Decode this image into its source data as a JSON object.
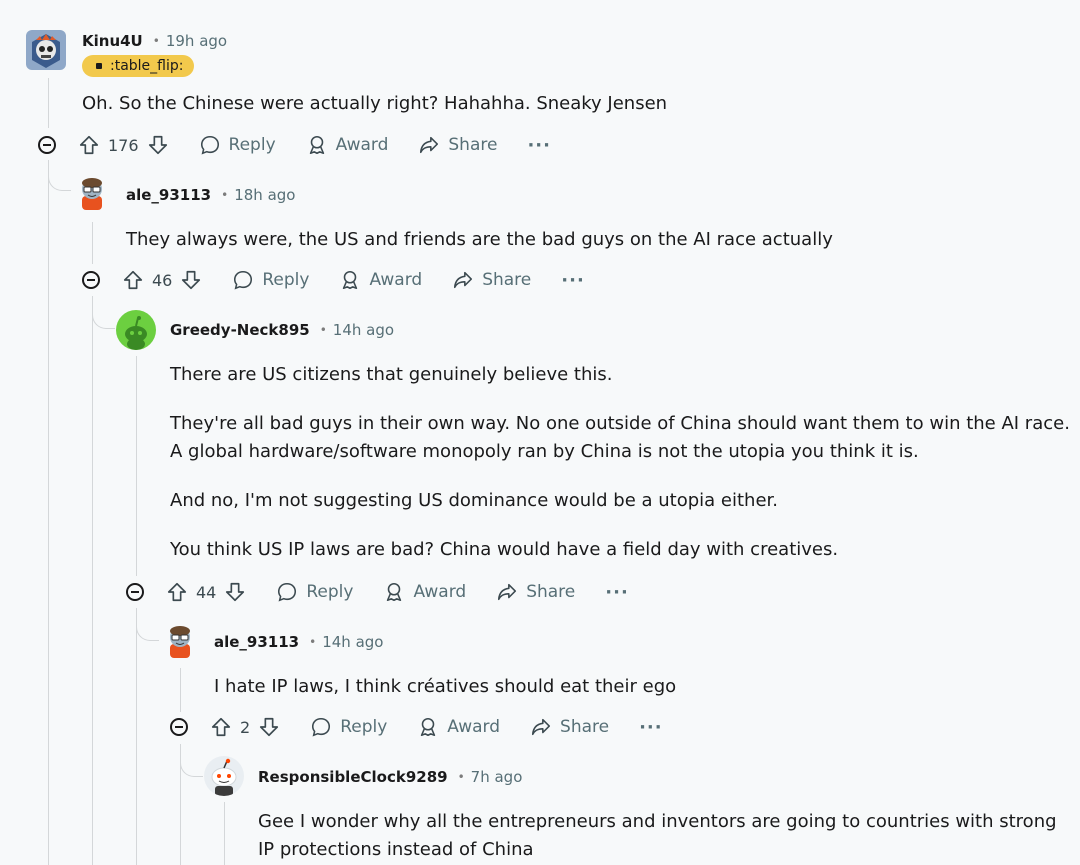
{
  "comments": [
    {
      "user": "Kinu4U",
      "time": "19h ago",
      "flair": ":table_flip:",
      "body": [
        "Oh. So the Chinese were actually right? Hahahha. Sneaky Jensen"
      ],
      "votes": "176",
      "reply_label": "Reply",
      "award_label": "Award",
      "share_label": "Share",
      "more_label": "···"
    },
    {
      "user": "ale_93113",
      "time": "18h ago",
      "body": [
        "They always were, the US and friends are the bad guys on the AI race actually"
      ],
      "votes": "46",
      "reply_label": "Reply",
      "award_label": "Award",
      "share_label": "Share",
      "more_label": "···"
    },
    {
      "user": "Greedy-Neck895",
      "time": "14h ago",
      "body": [
        "There are US citizens that genuinely believe this.",
        "They're all bad guys in their own way. No one outside of China should want them to win the AI race.",
        "A global hardware/software monopoly ran by China is not the utopia you think it is.",
        "And no, I'm not suggesting US dominance would be a utopia either.",
        "You think US IP laws are bad? China would have a field day with creatives."
      ],
      "votes": "44",
      "reply_label": "Reply",
      "award_label": "Award",
      "share_label": "Share",
      "more_label": "···"
    },
    {
      "user": "ale_93113",
      "time": "14h ago",
      "body": [
        "I hate IP laws, I think créatives should eat their ego"
      ],
      "votes": "2",
      "reply_label": "Reply",
      "award_label": "Award",
      "share_label": "Share",
      "more_label": "···"
    },
    {
      "user": "ResponsibleClock9289",
      "time": "7h ago",
      "body": [
        "Gee I wonder why all the entrepreneurs and inventors are going to countries with strong",
        "IP protections instead of China"
      ]
    }
  ],
  "colors": {
    "flair_bg": "#f2c94c",
    "text_primary": "#1a1a1b",
    "text_meta": "#576f76",
    "thread_line": "#d4d7d9",
    "background": "#f7f9fa",
    "greedy_avatar_bg": "#6ccf40"
  },
  "icons": [
    "collapse-icon",
    "upvote-icon",
    "downvote-icon",
    "reply-bubble-icon",
    "award-icon",
    "share-arrow-icon",
    "more-dots-icon"
  ]
}
